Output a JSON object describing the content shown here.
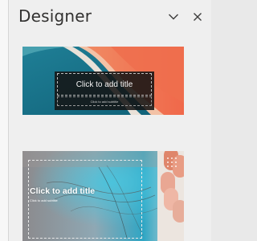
{
  "pane": {
    "title": "Designer",
    "collapse_icon": "chevron-down-icon",
    "close_icon": "close-icon"
  },
  "designs": [
    {
      "title_placeholder": "Click to add title",
      "subtitle_placeholder": "Click to add subtitle"
    },
    {
      "title_placeholder": "Click to add title",
      "subtitle_placeholder": "Click to add subtitle"
    }
  ]
}
